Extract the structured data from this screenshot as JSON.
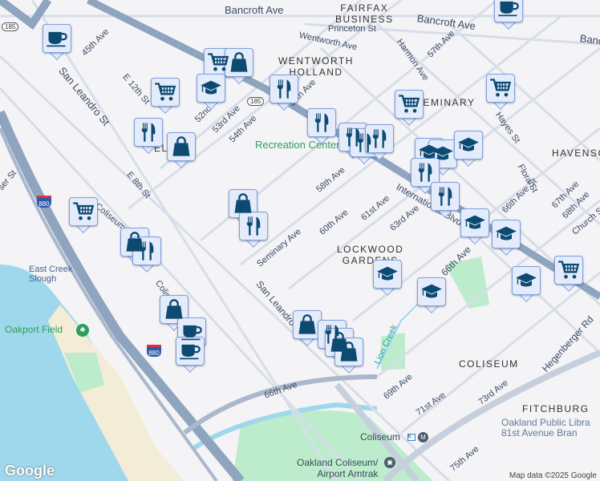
{
  "neighborhoods": {
    "fairfax": "FAIRFAX\nBUSINESS",
    "wentworth": "WENTWORTH\nHOLLAND",
    "seminary": "SEMINARY",
    "havenscourt": "HAVENSC",
    "lockwood": "LOCKWOOD\nGARDENS",
    "coliseum": "COLISEUM",
    "fitchburg": "FITCHBURG",
    "mel": "EL"
  },
  "streets": [
    "Bancroft Ave",
    "Bancroft Ave",
    "Princeton St",
    "Wentworth Ave",
    "Harmon Ave",
    "57th Ave",
    "45th Ave",
    "San Leandro St",
    "E 12th St",
    "52nd Ave",
    "53rd Ave",
    "54th Ave",
    "55th Ave",
    "E 8th St",
    "Coliseum Way",
    "Seminary Ave",
    "58th Ave",
    "60th Ave",
    "61st Ave",
    "63rd Ave",
    "International Blvd",
    "Hayes St",
    "Flora St",
    "66th Ave St",
    "67th Ave",
    "68th Ave",
    "Church St",
    "66th Ave",
    "San Leandro St",
    "69th Ave",
    "71st Ave",
    "73rd Ave",
    "75th Ave",
    "Hegenberger Rd",
    "Lion Creek",
    "66th Ave",
    "Coliseum Way",
    "ser St"
  ],
  "places": {
    "rec": "Recreation Center",
    "slough": "East Creek\nSlough",
    "oakport": "Oakport Field",
    "library": "Oakland Public Libra\n81st Avenue Bran",
    "coliseum_station": "Coliseum",
    "amtrak": "Oakland Coliseum/\nAirport Amtrak"
  },
  "shields": {
    "sr185": "185",
    "i880": "880"
  },
  "markers": [
    "cafe",
    "cart",
    "shopping-bag",
    "cart",
    "school",
    "restaurant",
    "restaurant",
    "shopping-bag",
    "cart",
    "cart",
    "restaurant",
    "restaurant",
    "restaurant",
    "restaurant",
    "school",
    "school",
    "school",
    "restaurant",
    "restaurant",
    "school",
    "school",
    "shopping-bag",
    "restaurant",
    "cart",
    "shopping-bag",
    "restaurant",
    "shopping-bag",
    "cafe",
    "cafe",
    "shopping-bag",
    "restaurant",
    "shopping-bag",
    "shopping-bag",
    "school",
    "school",
    "school",
    "cart",
    "cafe"
  ],
  "logo": "Google",
  "attribution": "Map data ©2025 Google",
  "colors": {
    "marker_bg": "#e4ecfb",
    "marker_icon": "#0d4a72",
    "freeway": "#8ea4bf",
    "water": "#9fd8ec",
    "park": "#bdeccd"
  }
}
